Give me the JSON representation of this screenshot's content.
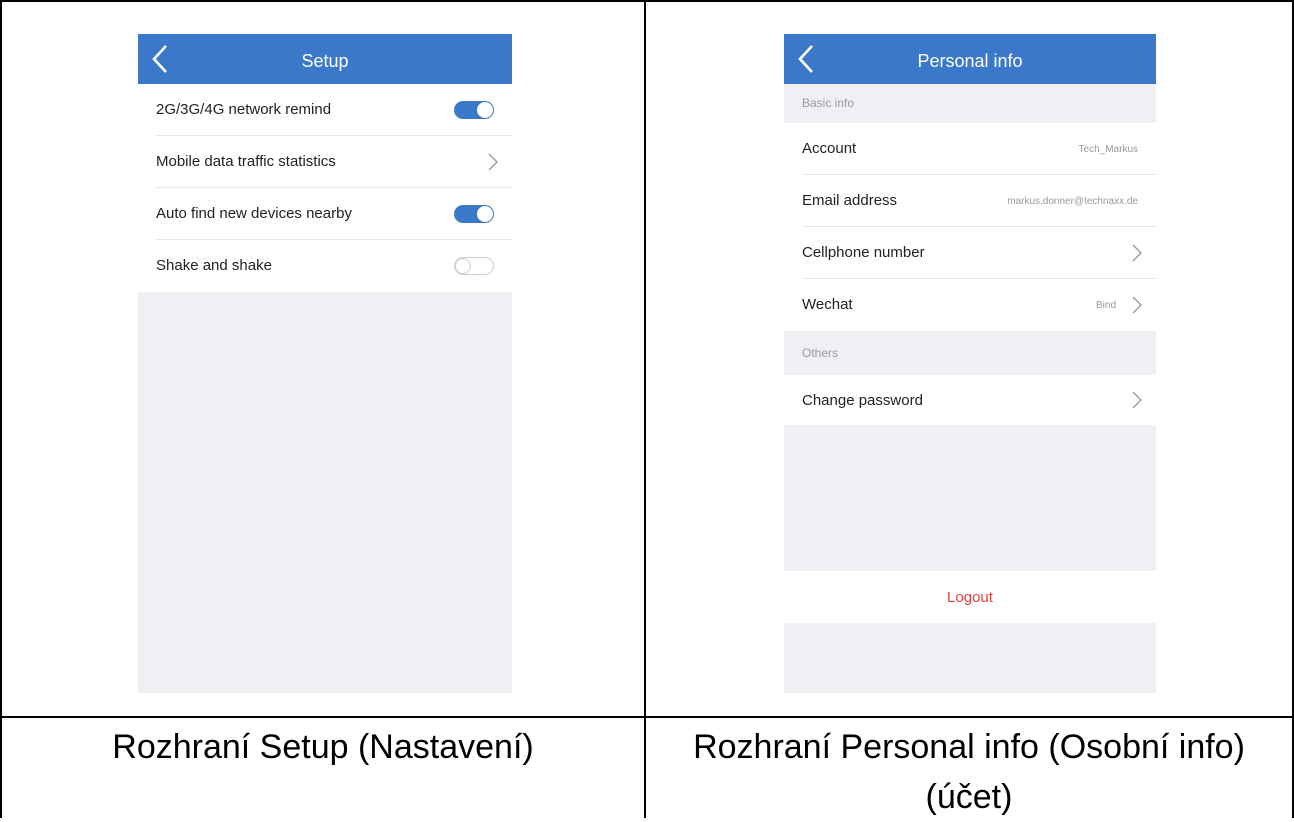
{
  "setup_screen": {
    "title": "Setup",
    "rows": [
      {
        "label": "2G/3G/4G network remind",
        "control": "toggle",
        "on": true
      },
      {
        "label": "Mobile data traffic statistics",
        "control": "chevron"
      },
      {
        "label": "Auto find new devices nearby",
        "control": "toggle",
        "on": true
      },
      {
        "label": "Shake and shake",
        "control": "toggle",
        "on": false
      }
    ],
    "accent": "#3b78c9"
  },
  "personal_screen": {
    "title": "Personal info",
    "section_basic": "Basic info",
    "rows": [
      {
        "label": "Account",
        "value": "Tech_Markus"
      },
      {
        "label": "Email address",
        "value": "markus.donner@technaxx.de"
      },
      {
        "label": "Cellphone number",
        "value": ""
      },
      {
        "label": "Wechat",
        "value": "Bind"
      }
    ],
    "section_others": "Others",
    "change_password": "Change password",
    "logout": "Logout",
    "logout_color": "#e2413d"
  },
  "captions": {
    "left": "Rozhraní Setup (Nastavení)",
    "right_line1": "Rozhraní Personal info (Osobní info)",
    "right_line2": "(účet)"
  }
}
